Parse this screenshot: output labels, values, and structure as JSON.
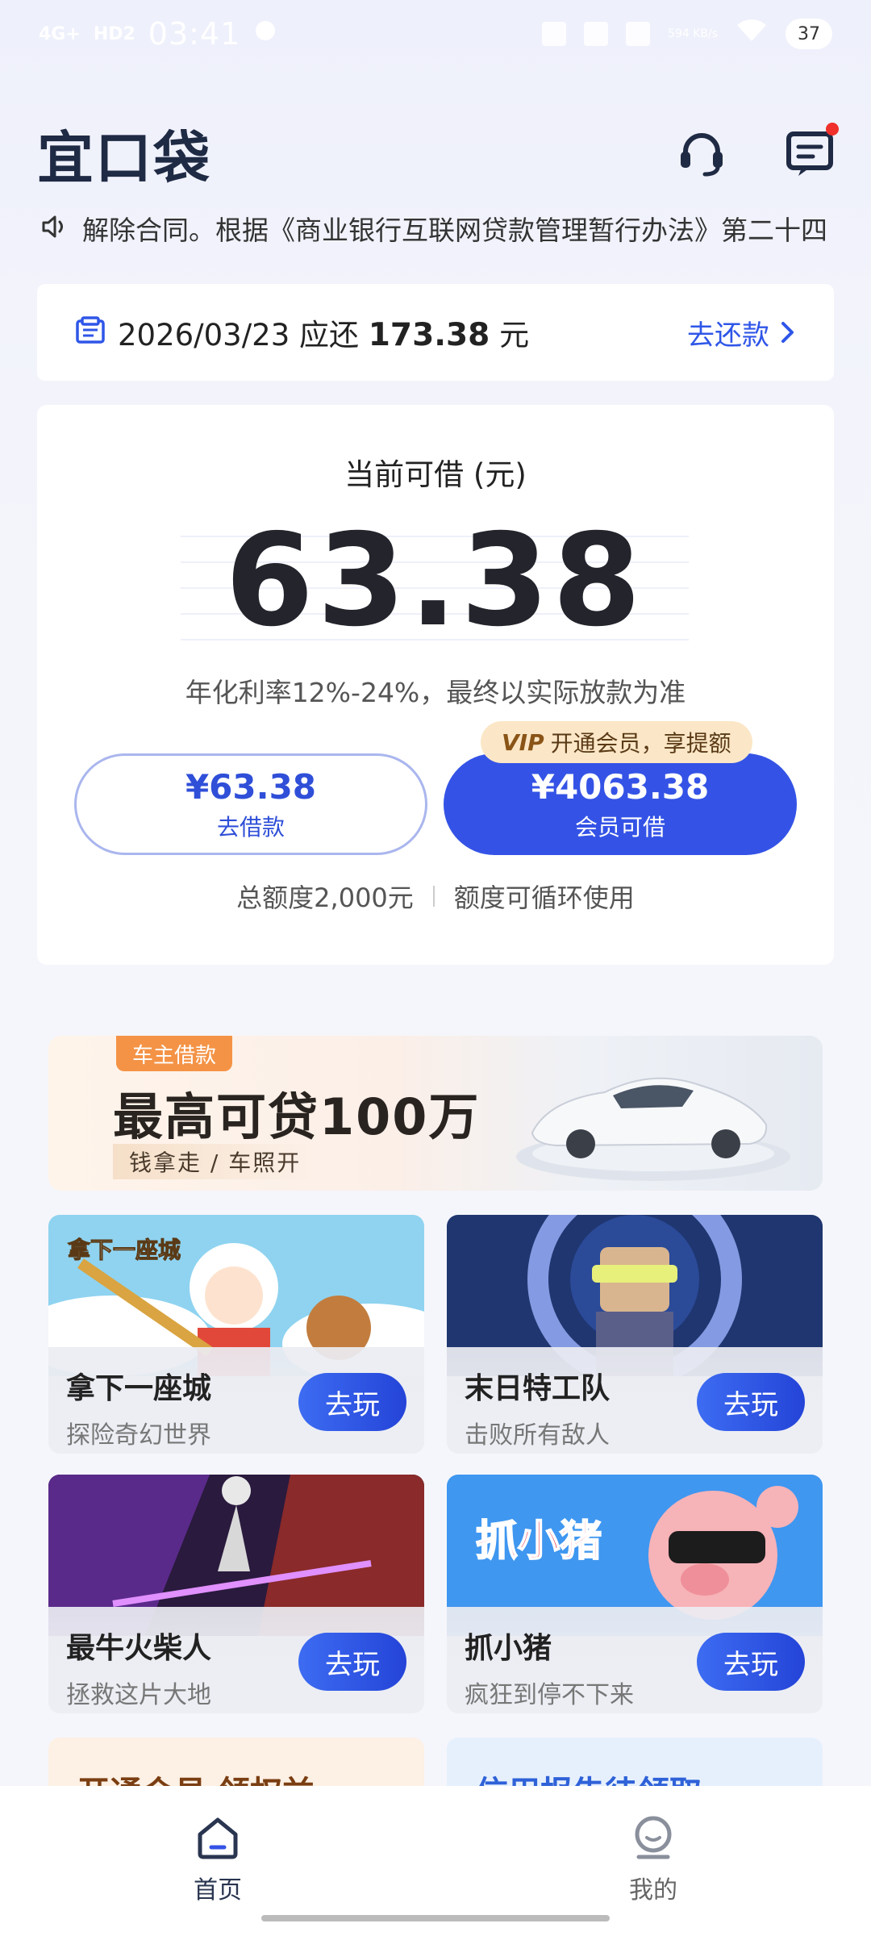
{
  "status_bar": {
    "signal": "4G+",
    "hd": "HD2",
    "time": "03:41",
    "net_speed": "594 KB/s",
    "battery": "37"
  },
  "header": {
    "logo": "宜口袋"
  },
  "marquee": {
    "text": "解除合同。根据《商业银行互联网贷款管理暂行办法》第二十四"
  },
  "repay": {
    "date": "2026/03/23",
    "due_label": "应还",
    "amount": "173.38",
    "unit": "元",
    "action": "去还款"
  },
  "loan": {
    "title": "当前可借 (元)",
    "amount": "63.38",
    "rate_note": "年化利率12%-24%，最终以实际放款为准",
    "borrow_amount": "¥63.38",
    "borrow_label": "去借款",
    "vip_tag_logo": "VIP",
    "vip_tag_text": "开通会员，享提额",
    "vip_amount": "¥4063.38",
    "vip_label": "会员可借",
    "total_credit": "总额度2,000元",
    "recycle_note": "额度可循环使用"
  },
  "car_banner": {
    "tag": "车主借款",
    "title": "最高可贷100万",
    "subtitle": "钱拿走 / 车照开"
  },
  "games": [
    {
      "name": "拿下一座城",
      "desc": "探险奇幻世界",
      "button": "去玩",
      "art_title": "拿下一座城"
    },
    {
      "name": "末日特工队",
      "desc": "击败所有敌人",
      "button": "去玩"
    },
    {
      "name": "最牛火柴人",
      "desc": "拯救这片大地",
      "button": "去玩"
    },
    {
      "name": "抓小猪",
      "desc": "疯狂到停不下来",
      "button": "去玩",
      "art_title": "抓小猪"
    }
  ],
  "partial_cards": [
    {
      "text": "开通会员 领权益"
    },
    {
      "text": "信用报告待领取"
    }
  ],
  "bottom_nav": {
    "home": "首页",
    "mine": "我的"
  },
  "colors": {
    "primary": "#3453e6",
    "link": "#2f56e8",
    "vip_tag_bg": "#fbe7c7",
    "car_tag": "#f49346"
  }
}
